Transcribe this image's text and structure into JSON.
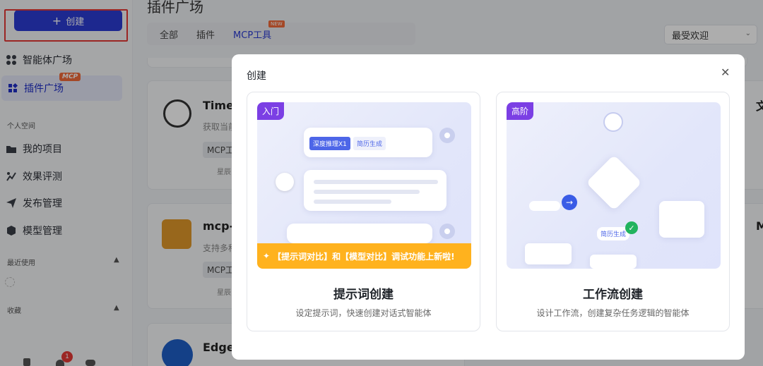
{
  "sidebar": {
    "create_label": "创建",
    "nav": [
      {
        "label": "智能体广场",
        "icon": "grid-icon"
      },
      {
        "label": "插件广场",
        "icon": "plugin-icon",
        "badge": "MCP"
      }
    ],
    "personal_label": "个人空间",
    "personal": [
      {
        "label": "我的项目",
        "icon": "folder-icon"
      },
      {
        "label": "效果评测",
        "icon": "evaluate-icon"
      },
      {
        "label": "发布管理",
        "icon": "send-icon"
      },
      {
        "label": "模型管理",
        "icon": "cube-icon"
      }
    ],
    "recent_label": "最近使用",
    "favorites_label": "收藏",
    "notification_count": "1"
  },
  "main": {
    "title": "插件广场",
    "tabs": [
      "全部",
      "插件",
      "MCP工具"
    ],
    "new_badge": "NEW",
    "sort": "最受欢迎",
    "cards": [
      {
        "title": "Time-",
        "desc": "获取当前",
        "chip": "MCP工",
        "meta": "星辰"
      },
      {
        "title": "mcp-",
        "desc": "支持多种",
        "chip": "MCP工",
        "meta": "星辰"
      },
      {
        "title": "Edge",
        "desc": "",
        "chip": "",
        "meta": ""
      }
    ],
    "right_cards": [
      "文",
      "M"
    ]
  },
  "modal": {
    "title": "创建",
    "options": [
      {
        "tag": "入门",
        "tag_color": "#7b3fe4",
        "title": "提示词创建",
        "desc": "设定提示词，快速创建对话式智能体",
        "pill1": "深度推理X1",
        "pill2": "简历生成",
        "promo": "【提示词对比】和【模型对比】调试功能上新啦!"
      },
      {
        "tag": "高阶",
        "tag_color": "#7b3fe4",
        "title": "工作流创建",
        "desc": "设计工作流，创建复杂任务逻辑的智能体",
        "pill": "简历生成"
      }
    ]
  }
}
